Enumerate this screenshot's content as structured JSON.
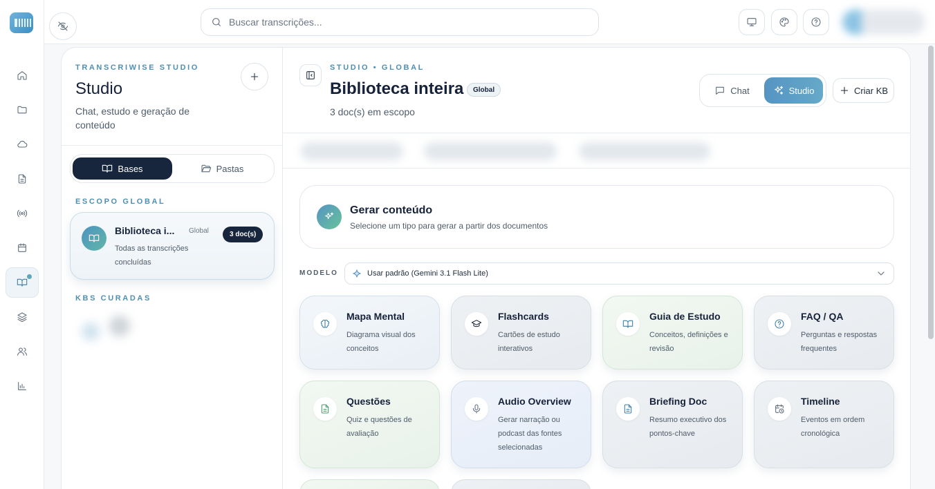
{
  "search": {
    "placeholder": "Buscar transcrições..."
  },
  "panel": {
    "eyebrow": "TRANSCRIWISE STUDIO",
    "title": "Studio",
    "subtitle": "Chat, estudo e geração de conteúdo",
    "tabs": [
      {
        "label": "Bases",
        "icon": "book-open-icon",
        "active": true
      },
      {
        "label": "Pastas",
        "icon": "folder-open-icon",
        "active": false
      }
    ],
    "global_scope_label": "ESCOPO GLOBAL",
    "kb": {
      "title": "Biblioteca i...",
      "tag": "Global",
      "count": "3 doc(s)",
      "description": "Todas as transcrições concluídas"
    },
    "curated_label": "KBS CURADAS"
  },
  "main": {
    "eyebrow": "STUDIO • GLOBAL",
    "title": "Biblioteca inteira",
    "chip": "Global",
    "scope": "3 doc(s) em escopo",
    "toggle": {
      "chat": "Chat",
      "studio": "Studio"
    },
    "create_kb": "Criar KB",
    "generate": {
      "title": "Gerar conteúdo",
      "subtitle": "Selecione um tipo para gerar a partir dos documentos"
    },
    "model": {
      "label": "MODELO",
      "value": "Usar padrão (Gemini 3.1 Flash Lite)"
    },
    "cards": [
      {
        "title": "Mapa Mental",
        "desc": "Diagrama visual dos conceitos",
        "icon": "brain-icon"
      },
      {
        "title": "Flashcards",
        "desc": "Cartões de estudo interativos",
        "icon": "graduation-cap-icon"
      },
      {
        "title": "Guia de Estudo",
        "desc": "Conceitos, definições e revisão",
        "icon": "book-icon"
      },
      {
        "title": "FAQ / QA",
        "desc": "Perguntas e respostas frequentes",
        "icon": "help-circle-icon"
      },
      {
        "title": "Questões",
        "desc": "Quiz e questões de avaliação",
        "icon": "file-text-icon"
      },
      {
        "title": "Audio Overview",
        "desc": "Gerar narração ou podcast das fontes selecionadas",
        "icon": "microphone-icon"
      },
      {
        "title": "Briefing Doc",
        "desc": "Resumo executivo dos pontos-chave",
        "icon": "document-icon"
      },
      {
        "title": "Timeline",
        "desc": "Eventos em ordem cronológica",
        "icon": "calendar-clock-icon"
      }
    ]
  },
  "colors": {
    "accent": "#5594c2",
    "navy": "#17253d",
    "eyebrow": "#4f8fb3"
  }
}
